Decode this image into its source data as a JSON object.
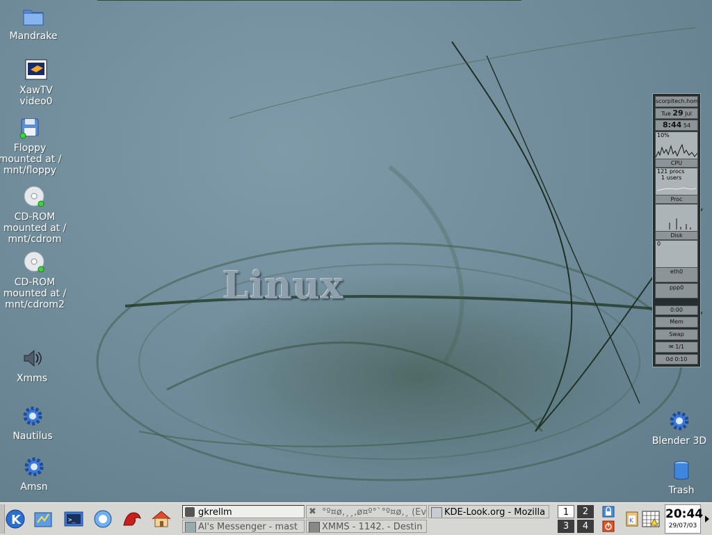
{
  "desktop": {
    "wallpaper_text": "Linux",
    "icons": [
      {
        "label": "Mandrake",
        "icon": "folder-icon"
      },
      {
        "label": "XawTV video0",
        "icon": "tv-icon"
      },
      {
        "label": "Floppy mounted at / mnt/floppy",
        "icon": "floppy-icon"
      },
      {
        "label": "CD-ROM mounted at / mnt/cdrom",
        "icon": "cdrom-icon"
      },
      {
        "label": "CD-ROM mounted at / mnt/cdrom2",
        "icon": "cdrom-icon"
      },
      {
        "label": "Xmms",
        "icon": "speaker-icon"
      },
      {
        "label": "Nautilus",
        "icon": "gear-icon"
      },
      {
        "label": "Amsn",
        "icon": "gear-icon"
      },
      {
        "label": "Blender 3D",
        "icon": "gear-icon"
      },
      {
        "label": "Trash",
        "icon": "trash-icon"
      }
    ]
  },
  "gkrellm": {
    "hostname": "scorpitech.hom",
    "day": "Tue",
    "date_num": "29",
    "month": "Jul",
    "time": "8:44",
    "seconds": "54",
    "cpu_percent": "10%",
    "cpu_label": "CPU",
    "procs": "121 procs",
    "users": "1 users",
    "proc_label": "Proc",
    "disk_label": "Disk",
    "net_zero": "0",
    "eth_label": "eth0",
    "ppp_label": "ppp0",
    "ppp_time": "0:00",
    "mem_label": "Mem",
    "swap_label": "Swap",
    "mail_count": "1/1",
    "uptime": "0d 0:10"
  },
  "taskbar": {
    "tasks": [
      {
        "label": "gkrellm",
        "active": true
      },
      {
        "label": "°º¤ø,¸¸,ø¤º°`°º¤ø,¸ (Eve",
        "active": false
      },
      {
        "label": "KDE-Look.org - Mozilla",
        "active": false
      },
      {
        "label": "Al's Messenger - mast",
        "active": false
      },
      {
        "label": "XMMS - 1142. - Destin",
        "active": false
      }
    ],
    "pager": [
      "1",
      "2",
      "3",
      "4"
    ],
    "clock_time": "20:44",
    "clock_date": "29/07/03"
  }
}
